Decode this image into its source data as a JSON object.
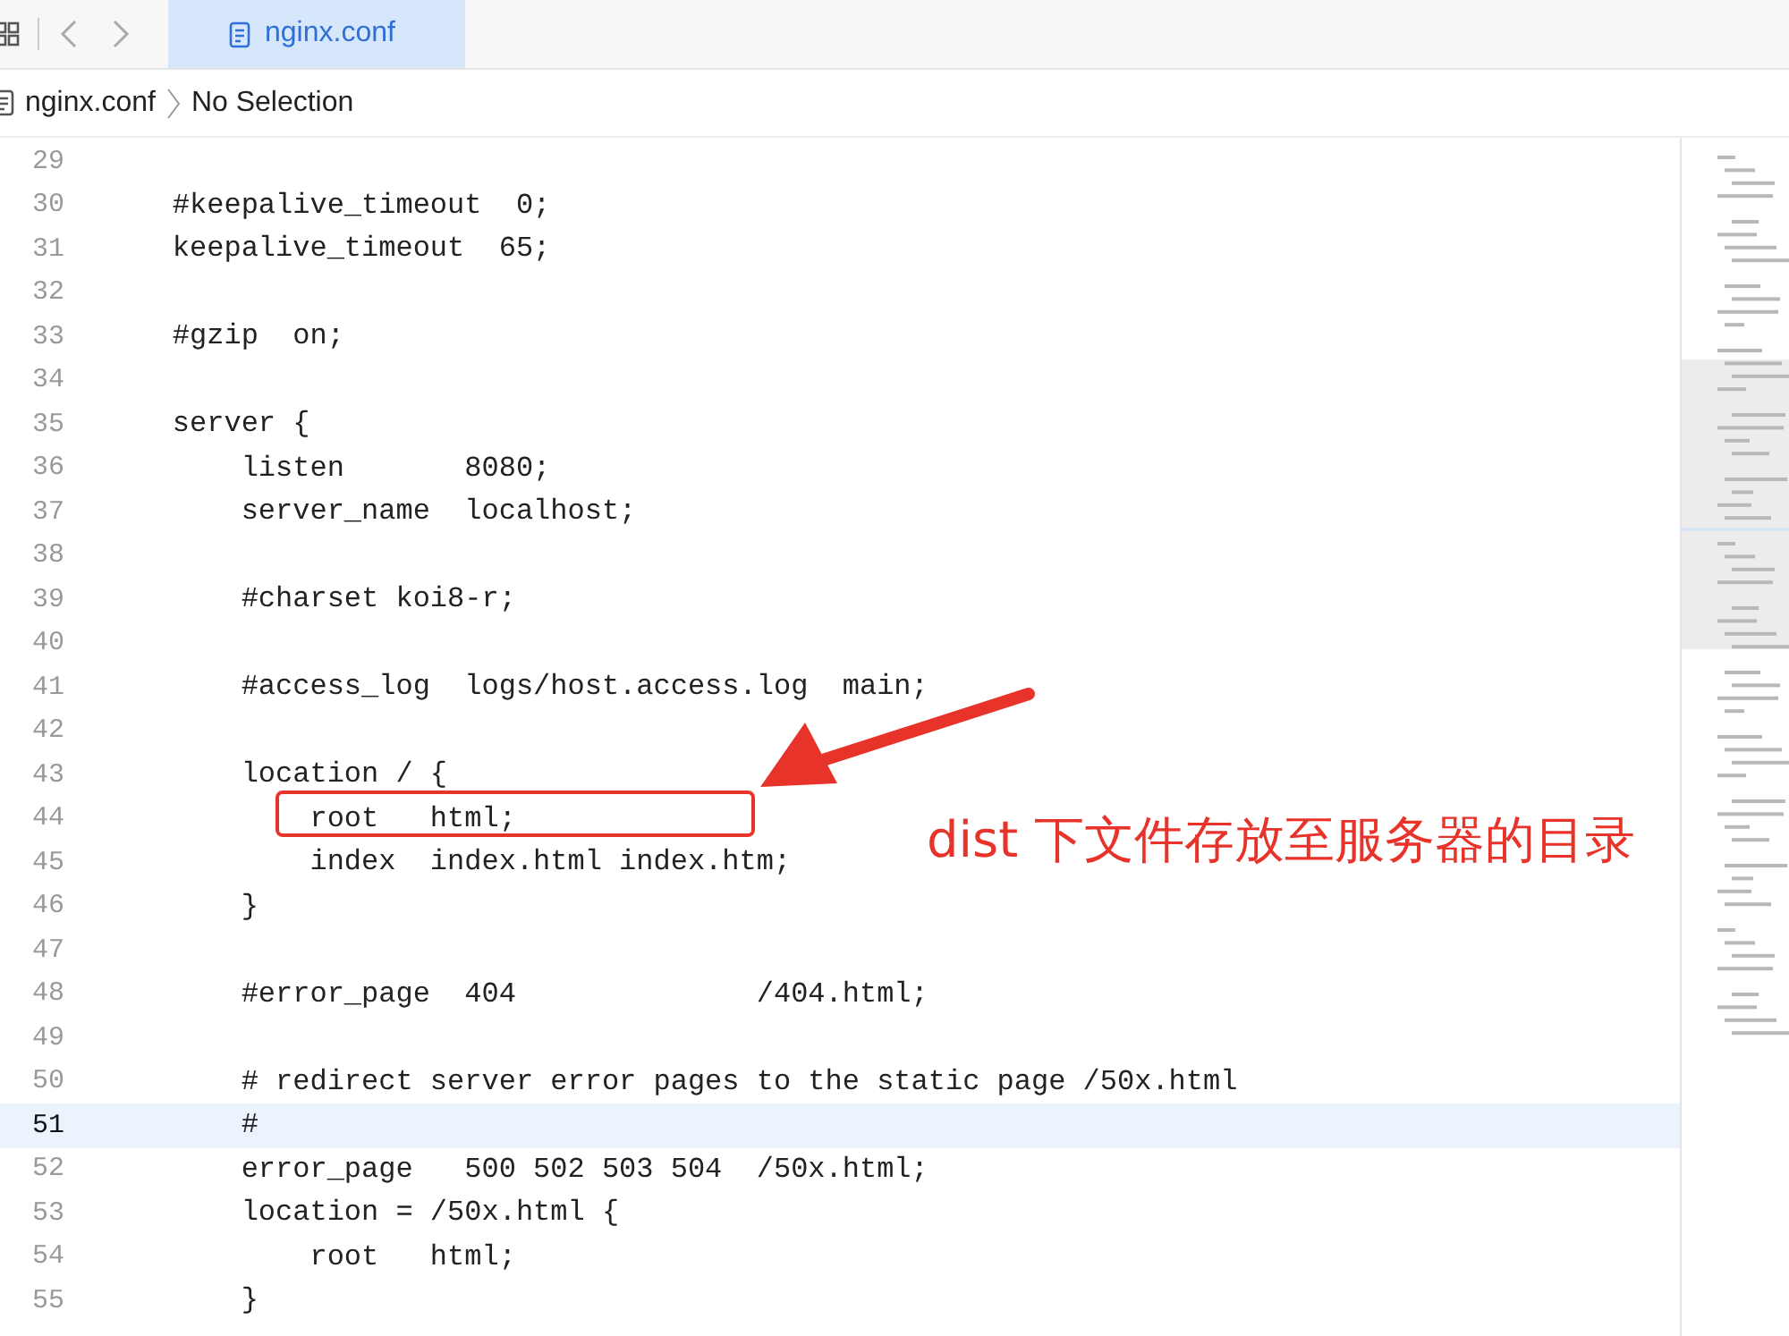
{
  "tab": {
    "label": "nginx.conf",
    "selected": true
  },
  "breadcrumb": {
    "file": "nginx.conf",
    "selection": "No Selection"
  },
  "lines": [
    {
      "number": "29",
      "current": false
    },
    {
      "number": "30",
      "text": "    #keepalive_timeout  0;",
      "current": false
    },
    {
      "number": "31",
      "text": "    keepalive_timeout  65;",
      "current": false
    },
    {
      "number": "32",
      "current": false
    },
    {
      "number": "33",
      "text": "    #gzip  on;",
      "current": false
    },
    {
      "number": "34",
      "current": false
    },
    {
      "number": "35",
      "text": "    server {",
      "current": false
    },
    {
      "number": "36",
      "text": "        listen       8080;",
      "current": false
    },
    {
      "number": "37",
      "text": "        server_name  localhost;",
      "current": false
    },
    {
      "number": "38",
      "current": false
    },
    {
      "number": "39",
      "text": "        #charset koi8-r;",
      "current": false
    },
    {
      "number": "40",
      "current": false
    },
    {
      "number": "41",
      "text": "        #access_log  logs/host.access.log  main;",
      "current": false
    },
    {
      "number": "42",
      "current": false
    },
    {
      "number": "43",
      "text": "        location / {",
      "current": false
    },
    {
      "number": "44",
      "text": "            root   html;",
      "current": false
    },
    {
      "number": "45",
      "text": "            index  index.html index.htm;",
      "current": false
    },
    {
      "number": "46",
      "text": "        }",
      "current": false
    },
    {
      "number": "47",
      "current": false
    },
    {
      "number": "48",
      "text": "        #error_page  404              /404.html;",
      "current": false
    },
    {
      "number": "49",
      "current": false
    },
    {
      "number": "50",
      "text": "        # redirect server error pages to the static page /50x.html",
      "current": false
    },
    {
      "number": "51",
      "text": "        #",
      "current": true
    },
    {
      "number": "52",
      "text": "        error_page   500 502 503 504  /50x.html;",
      "current": false
    },
    {
      "number": "53",
      "text": "        location = /50x.html {",
      "current": false
    },
    {
      "number": "54",
      "text": "            root   html;",
      "current": false
    },
    {
      "number": "55",
      "text": "        }",
      "current": false
    }
  ],
  "annotation": {
    "text": "dist 下文件存放至服务器的目录"
  }
}
